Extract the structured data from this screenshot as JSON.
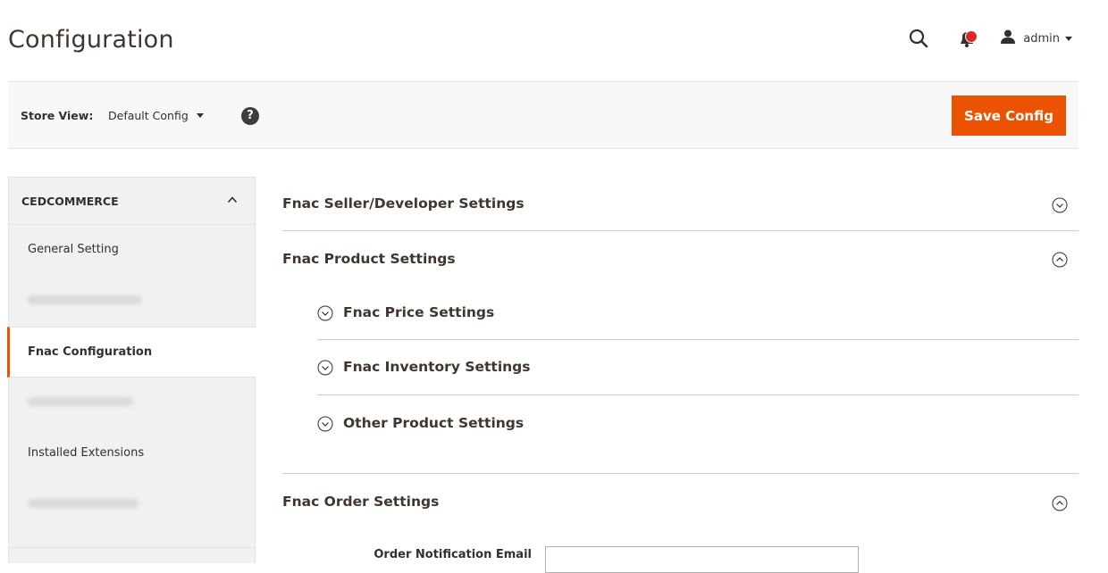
{
  "header": {
    "title": "Configuration",
    "user": {
      "name": "admin"
    }
  },
  "store_bar": {
    "label": "Store View:",
    "selected": "Default Config",
    "help": "?",
    "save_label": "Save Config"
  },
  "sidebar": {
    "group_title": "CEDCOMMERCE",
    "items": [
      {
        "label": "General Setting",
        "blurred": false,
        "active": false
      },
      {
        "label": "",
        "blurred": true,
        "active": false
      },
      {
        "label": "Fnac Configuration",
        "blurred": false,
        "active": true
      },
      {
        "label": "",
        "blurred": true,
        "active": false
      },
      {
        "label": "Installed Extensions",
        "blurred": false,
        "active": false
      },
      {
        "label": "",
        "blurred": true,
        "active": false
      }
    ]
  },
  "main": {
    "sections": [
      {
        "title": "Fnac Seller/Developer Settings",
        "expanded": false
      },
      {
        "title": "Fnac Product Settings",
        "expanded": true,
        "subsections": [
          {
            "title": "Fnac Price Settings",
            "expanded": false
          },
          {
            "title": "Fnac Inventory Settings",
            "expanded": false
          },
          {
            "title": "Other Product Settings",
            "expanded": false
          }
        ]
      },
      {
        "title": "Fnac Order Settings",
        "expanded": true
      }
    ],
    "order_field": {
      "label": "Order Notification Email",
      "value": ""
    }
  },
  "colors": {
    "accent": "#eb5202",
    "badge": "#e22626",
    "sidebar_bg": "#f1f1f1"
  }
}
